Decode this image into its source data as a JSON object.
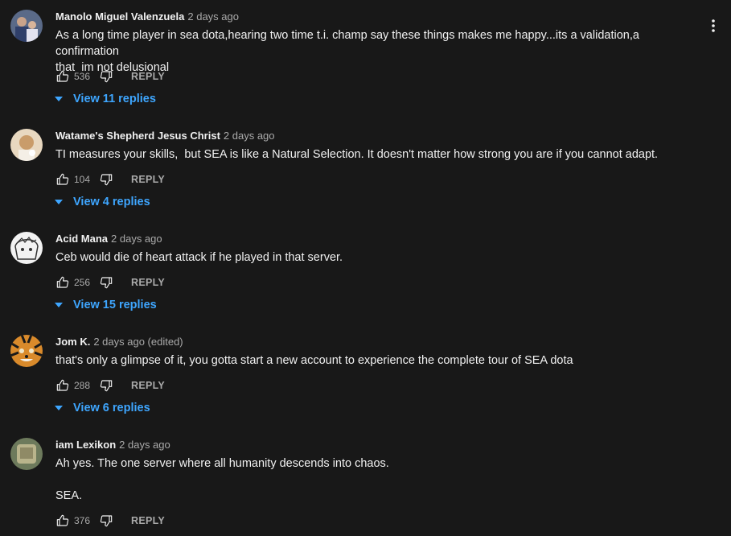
{
  "menu": {
    "icon": "more-vert-icon"
  },
  "comments": [
    {
      "author": "Manolo Miguel Valenzuela",
      "time": "2 days ago",
      "lines": [
        "As a long time player in sea dota,hearing two time t.i. champ say these things makes me happy...its a validation,a confirmation",
        "that  im not delusional"
      ],
      "likes": "536",
      "reply_label": "REPLY",
      "view_replies": "View 11 replies"
    },
    {
      "author": "Watame's Shepherd Jesus Christ",
      "time": "2 days ago",
      "lines": [
        "TI measures your skills,  but SEA is like a Natural Selection. It doesn't matter how strong you are if you cannot adapt."
      ],
      "likes": "104",
      "reply_label": "REPLY",
      "view_replies": "View 4 replies"
    },
    {
      "author": "Acid Mana",
      "time": "2 days ago",
      "lines": [
        "Ceb would die of heart attack if he played in that server."
      ],
      "likes": "256",
      "reply_label": "REPLY",
      "view_replies": "View 15 replies"
    },
    {
      "author": "Jom K.",
      "time": "2 days ago (edited)",
      "lines": [
        "that's only a glimpse of it, you gotta start a new account to experience the complete tour of SEA dota"
      ],
      "likes": "288",
      "reply_label": "REPLY",
      "view_replies": "View 6 replies"
    },
    {
      "author": "iam Lexikon",
      "time": "2 days ago",
      "lines": [
        "Ah yes. The one server where all humanity descends into chaos.",
        "",
        "SEA."
      ],
      "likes": "376",
      "reply_label": "REPLY",
      "view_replies": ""
    }
  ],
  "colors": {
    "background": "#181818",
    "text": "#f1f1f1",
    "secondary": "#aaaaaa",
    "link": "#3ea6ff"
  }
}
